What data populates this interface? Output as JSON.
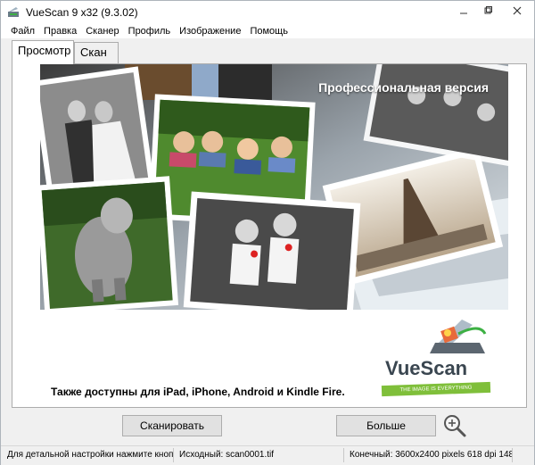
{
  "window": {
    "title": "VueScan 9 x32 (9.3.02)",
    "icon": "app-scanner-icon",
    "controls": {
      "minimize": "minimize-icon",
      "maximize": "maximize-icon",
      "close": "close-icon"
    }
  },
  "menu": [
    {
      "label": "Файл"
    },
    {
      "label": "Правка"
    },
    {
      "label": "Сканер"
    },
    {
      "label": "Профиль"
    },
    {
      "label": "Изображение"
    },
    {
      "label": "Помощь"
    }
  ],
  "tabs": {
    "preview": "Просмотр",
    "scan": "Скан",
    "active": "preview"
  },
  "banner": {
    "headline": "Профессиональная версия"
  },
  "promo": {
    "text": "Также доступны для iPad, iPhone, Android и Kindle Fire.",
    "logo_name": "VueScan",
    "logo_tagline": "THE IMAGE IS EVERYTHING"
  },
  "buttons": {
    "scan": "Сканировать",
    "more": "Больше",
    "zoom_icon": "zoom-in-icon"
  },
  "status": {
    "hint": "Для детальной настройки нажмите кноп...",
    "source": "Исходный: scan0001.tif",
    "output": "Конечный: 3600x2400 pixels 618 dpi 148x9..."
  },
  "colors": {
    "accent_green": "#7fbf3a",
    "window_bg": "#f0f0f0"
  }
}
